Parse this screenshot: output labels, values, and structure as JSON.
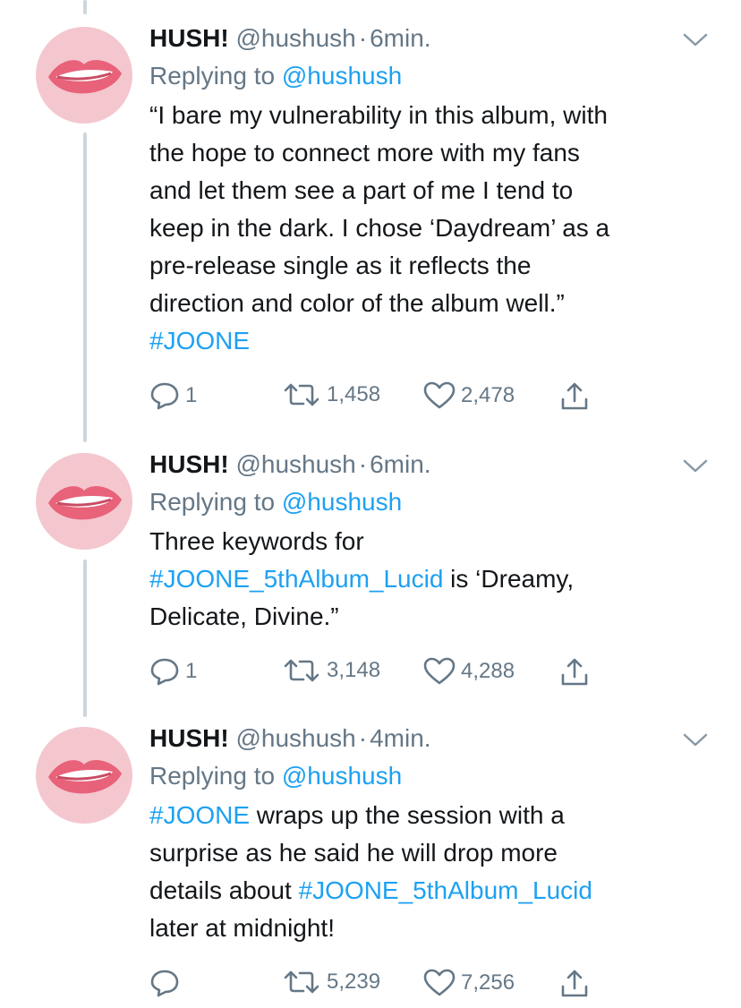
{
  "tweets": [
    {
      "name": "HUSH!",
      "handle": "@hushush",
      "dot": "·",
      "time": "6min.",
      "replying_prefix": "Replying to",
      "replying_to": "@hushush",
      "lines": [
        "“I bare my vulnerability in this album, with",
        "the hope to connect more with my fans",
        "and let them see a part of me I tend to",
        "keep in the dark. I chose ‘Daydream’ as a",
        "pre-release single as it reflects the",
        "direction and color of the album well.”"
      ],
      "hashtag": "#JOONE",
      "replies": "1",
      "retweets": "1,458",
      "likes": "2,478"
    },
    {
      "name": "HUSH!",
      "handle": "@hushush",
      "dot": "·",
      "time": "6min.",
      "replying_prefix": "Replying to",
      "replying_to": "@hushush",
      "line1": "Three keywords for",
      "hashtag": "#JOONE_5thAlbum_Lucid",
      "line2_rest": " is ‘Dreamy,",
      "line3": "Delicate, Divine.”",
      "replies": "1",
      "retweets": "3,148",
      "likes": "4,288"
    },
    {
      "name": "HUSH!",
      "handle": "@hushush",
      "dot": "·",
      "time": "4min.",
      "replying_prefix": "Replying to",
      "replying_to": "@hushush",
      "hashtag1": "#JOONE",
      "line1_rest": " wraps up the session with a",
      "line2": "surprise as he said he will drop more",
      "line3_pre": "details about ",
      "hashtag2": "#JOONE_5thAlbum_Lucid",
      "line4": "later at midnight!",
      "retweets": "5,239",
      "likes": "7,256"
    }
  ],
  "icons": {
    "avatar": "lips-avatar-icon",
    "reply": "reply-icon",
    "retweet": "retweet-icon",
    "like": "heart-icon",
    "share": "share-icon",
    "chevron": "chevron-down-icon"
  },
  "colors": {
    "link": "#1da1f2",
    "muted": "#657786",
    "avatar_bg": "#f4c7cf",
    "lips": "#e8627a"
  }
}
